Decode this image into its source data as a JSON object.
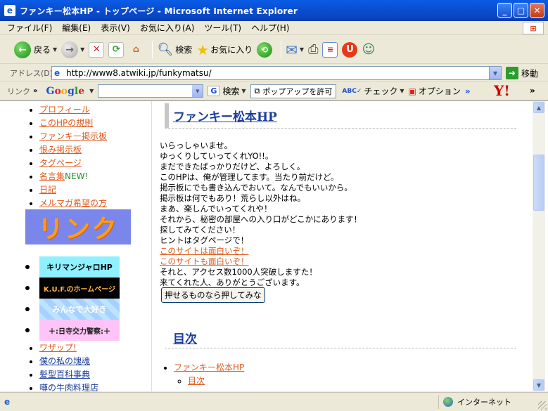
{
  "window": {
    "title": "ファンキー松本HP - トップページ - Microsoft Internet Explorer"
  },
  "menu": [
    "ファイル(F)",
    "編集(E)",
    "表示(V)",
    "お気に入り(A)",
    "ツール(T)",
    "ヘルプ(H)"
  ],
  "toolbar": {
    "back": "戻る",
    "search": "検索",
    "favorites": "お気に入り"
  },
  "address": {
    "label": "アドレス(D)",
    "url": "http://www8.atwiki.jp/funkymatsu/",
    "go": "移動"
  },
  "linkbar": {
    "label": "リンク",
    "google": "Google",
    "search": "検索",
    "popup": "ポップアップを許可",
    "check": "チェック",
    "options": "オプション"
  },
  "sidebar": {
    "items": [
      {
        "label": "プロフィール"
      },
      {
        "label": "このHPの規則"
      },
      {
        "label": "ファンキー掲示板"
      },
      {
        "label": "恨み掲示板"
      },
      {
        "label": "タグページ"
      },
      {
        "label": "名言集",
        "suffix": "NEW!"
      },
      {
        "label": "日記"
      },
      {
        "label": "メルマガ希望の方"
      }
    ],
    "banner_link": "リンク",
    "banners": [
      "キリマンジャロHP",
      "K.U.F.のホームページ",
      "みんなで大好き",
      "＋:日寺交力警察:＋"
    ],
    "lower_items": [
      "ワザップ!",
      "僕の私の塊魂",
      "髪型百科事典",
      "噂の牛肉料理店"
    ]
  },
  "main": {
    "title": "ファンキー松本HP",
    "lines": [
      "いらっしゃいませ。",
      "ゆっくりしていってくれYO!!。",
      "まだできたばっかりだけど、よろしく。",
      "このHPは、俺が管理してます。当たり前だけど。",
      "掲示板にでも書き込んでおいて。なんでもいいから。",
      "掲示板は何でもあり！荒らし以外はね。",
      "まあ、楽しんでいってくれや！",
      "それから、秘密の部屋への入り口がどこかにあります！",
      "探してみてください！",
      "ヒントはタグページで！"
    ],
    "links": [
      "このサイトは面白いぞ！",
      "このサイトも面白いぞ！"
    ],
    "after": [
      "それと、アクセス数1000人突破しますた！",
      "来てくれた人、ありがとうございます。"
    ],
    "push_button": "押せるものなら押してみな",
    "toc_title": "目次",
    "toc_item": "ファンキー松本HP",
    "toc_sub": "目次"
  },
  "status": {
    "zone": "インターネット"
  }
}
